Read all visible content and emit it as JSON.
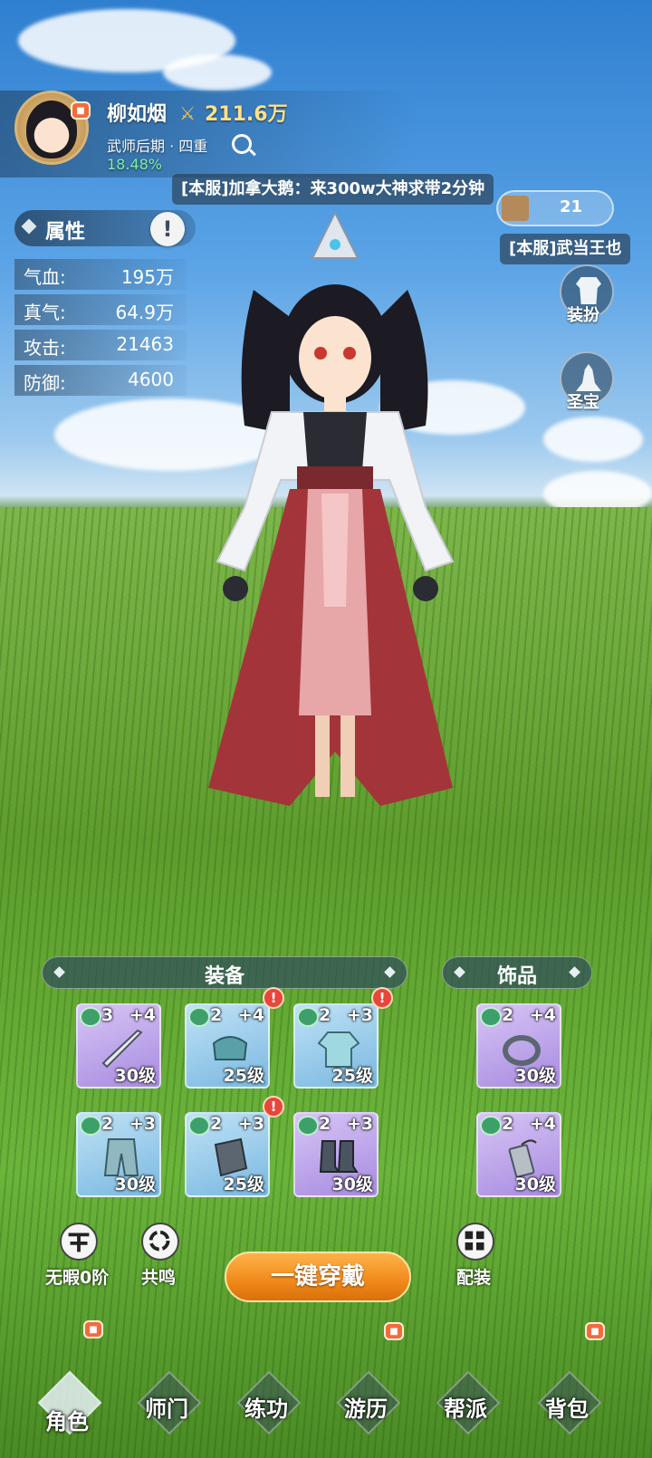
{
  "player": {
    "name": "柳如烟",
    "power": "211.6万",
    "rank": "武师后期 · 四重",
    "progress": "18.48%"
  },
  "chat": {
    "message_1": "[本服]加拿大鹅：来300w大神求带2分钟",
    "message_2": "[本服]武当王也",
    "counter": "21"
  },
  "attributes": {
    "title": "属性",
    "info": "!",
    "items": [
      {
        "label": "气血:",
        "value": "195万"
      },
      {
        "label": "真气:",
        "value": "64.9万"
      },
      {
        "label": "攻击:",
        "value": "21463"
      },
      {
        "label": "防御:",
        "value": "4600"
      }
    ]
  },
  "side_buttons": {
    "outfit": "装扮",
    "treasure": "圣宝"
  },
  "equipment": {
    "title": "装备",
    "slots": [
      {
        "count": "3",
        "plus": "+4",
        "level": "30级",
        "icon": "sword-icon",
        "rarity": "purple"
      },
      {
        "count": "2",
        "plus": "+4",
        "level": "25级",
        "icon": "helmet-icon",
        "rarity": "blue",
        "alert": true
      },
      {
        "count": "2",
        "plus": "+3",
        "level": "25级",
        "icon": "robe-icon",
        "rarity": "blue",
        "alert": true
      },
      {
        "count": "2",
        "plus": "+3",
        "level": "30级",
        "icon": "pants-icon",
        "rarity": "blue"
      },
      {
        "count": "2",
        "plus": "+3",
        "level": "25级",
        "icon": "bracer-icon",
        "rarity": "blue",
        "alert": true
      },
      {
        "count": "2",
        "plus": "+3",
        "level": "30级",
        "icon": "boots-icon",
        "rarity": "purple"
      }
    ]
  },
  "accessories": {
    "title": "饰品",
    "slots": [
      {
        "count": "2",
        "plus": "+4",
        "level": "30级",
        "icon": "ring-icon",
        "rarity": "purple"
      },
      {
        "count": "2",
        "plus": "+4",
        "level": "30级",
        "icon": "pendant-icon",
        "rarity": "purple"
      }
    ]
  },
  "actions": {
    "flawless": "无暇0阶",
    "resonance": "共鸣",
    "equip_all": "一键穿戴",
    "loadout": "配装"
  },
  "nav": {
    "items": [
      "角色",
      "师门",
      "练功",
      "游历",
      "帮派",
      "背包"
    ]
  },
  "colors": {
    "accent_orange": "#f08a1a",
    "power_gold": "#ffe08a",
    "progress_green": "#7ff0a8",
    "alert_red": "#e8463b"
  }
}
